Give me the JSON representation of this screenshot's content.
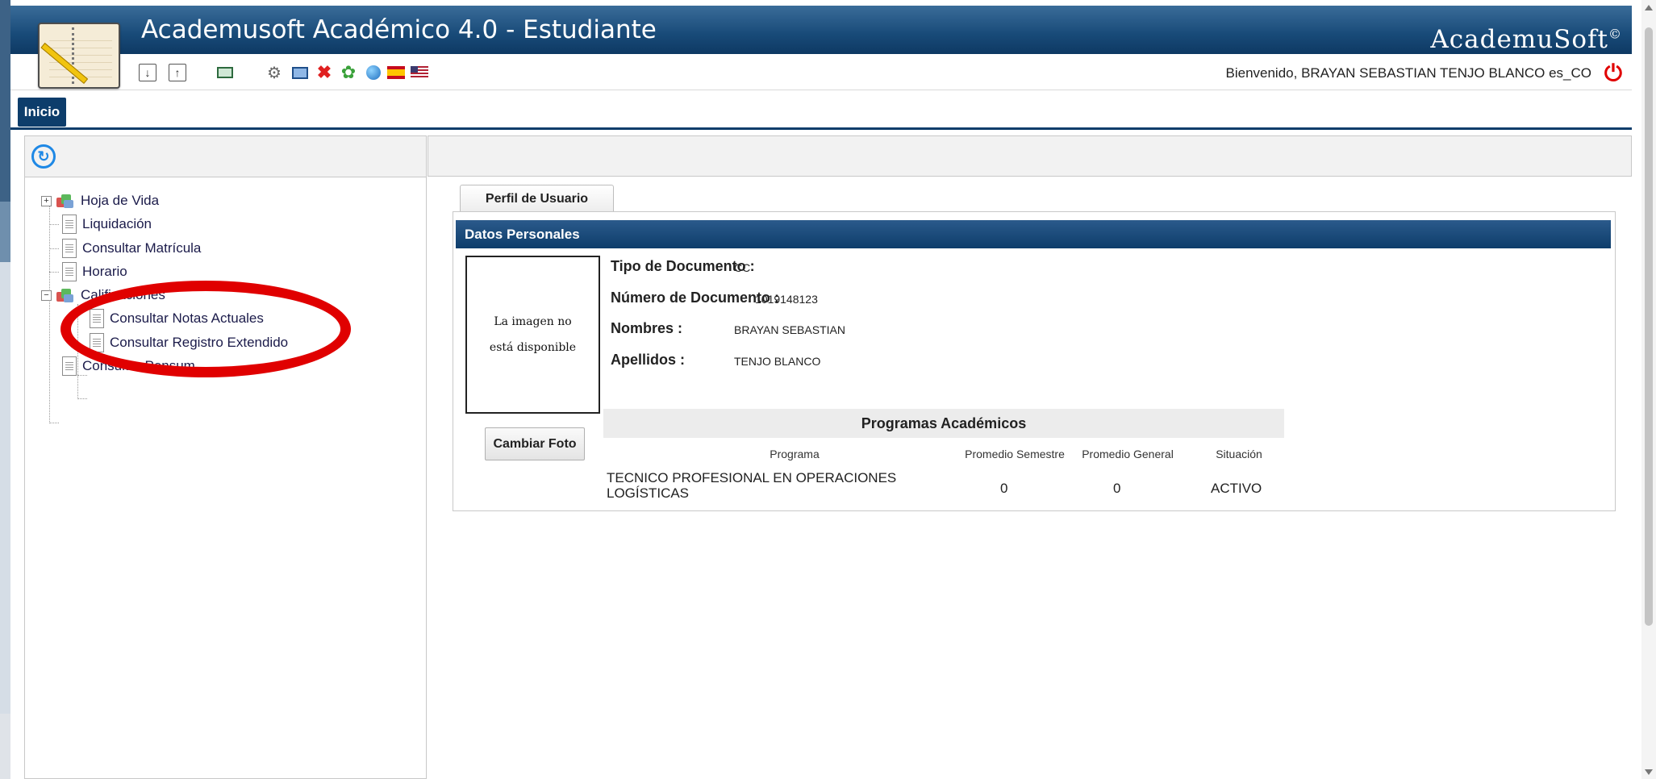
{
  "app": {
    "title": "Academusoft Académico 4.0 - Estudiante",
    "brand": "AcademuSoft",
    "brand_mark": "©",
    "welcome": "Bienvenido, BRAYAN SEBASTIAN TENJO BLANCO es_CO"
  },
  "toolbar": {
    "icons": [
      "download-icon",
      "upload-icon",
      "screen-icon",
      "gear-icon",
      "monitor-icon",
      "close-icon",
      "flower-icon",
      "globe-icon",
      "spain-flag-icon",
      "usa-flag-icon",
      "power-icon"
    ]
  },
  "nav": {
    "home": "Inicio"
  },
  "tree": {
    "hoja_vida": "Hoja de Vida",
    "liquidacion": "Liquidación",
    "matricula": "Consultar Matrícula",
    "horario": "Horario",
    "calificaciones": "Calificaciones",
    "notas": "Consultar Notas Actuales",
    "registro": "Consultar Registro Extendido",
    "pensum": "Consultar Pensum"
  },
  "profile": {
    "tab": "Perfil de Usuario",
    "section": "Datos Personales",
    "photo_line1": "La imagen no",
    "photo_line2": "está disponible",
    "change_photo": "Cambiar Foto",
    "fields": {
      "tipo_label": "Tipo de Documento :",
      "tipo_value": "CC",
      "numero_label": "Número de Documento :",
      "numero_value": "1019148123",
      "nombres_label": "Nombres :",
      "nombres_value": "BRAYAN SEBASTIAN",
      "apellidos_label": "Apellidos :",
      "apellidos_value": "TENJO BLANCO"
    }
  },
  "programs": {
    "title": "Programas Académicos",
    "headers": [
      "Programa",
      "Promedio Semestre",
      "Promedio General",
      "Situación"
    ],
    "rows": [
      {
        "programa_l1": "TECNICO PROFESIONAL EN OPERACIONES",
        "programa_l2": "LOGÍSTICAS",
        "semestre": "0",
        "general": "0",
        "situacion": "ACTIVO"
      }
    ]
  },
  "colors": {
    "header_dark": "#0d3d6b",
    "annotation": "#e00000",
    "power": "#e00000"
  }
}
